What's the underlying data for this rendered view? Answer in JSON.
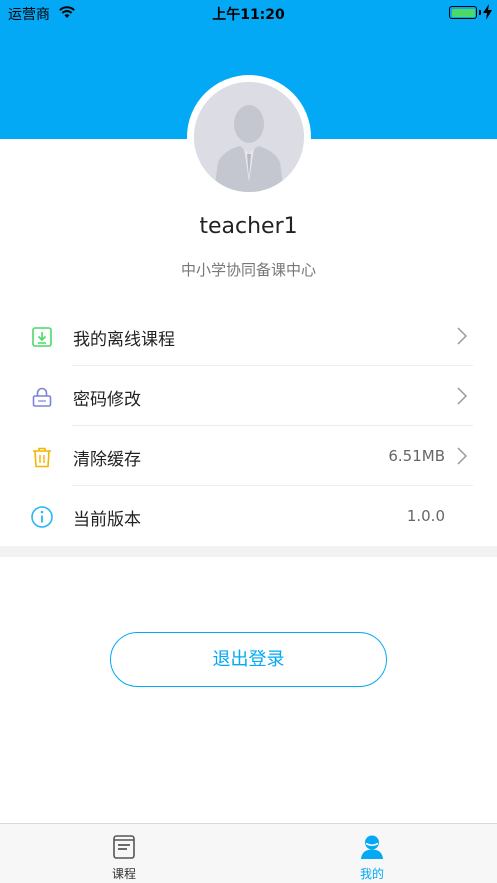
{
  "status_bar": {
    "carrier": "运营商",
    "time": "上午11:20"
  },
  "profile": {
    "username": "teacher1",
    "organization": "中小学协同备课中心"
  },
  "menu": [
    {
      "label": "我的离线课程",
      "value": "",
      "icon": "download-icon"
    },
    {
      "label": "密码修改",
      "value": "",
      "icon": "lock-icon"
    },
    {
      "label": "清除缓存",
      "value": "6.51MB",
      "icon": "trash-icon"
    },
    {
      "label": "当前版本",
      "value": "1.0.0",
      "icon": "info-icon"
    }
  ],
  "logout_label": "退出登录",
  "tabbar": {
    "courses": "课程",
    "mine": "我的"
  },
  "colors": {
    "accent": "#03a9f4",
    "download_icon": "#4cd964",
    "lock_icon": "#7b83d6",
    "trash_icon": "#f5b400",
    "info_icon": "#29b6f6"
  }
}
